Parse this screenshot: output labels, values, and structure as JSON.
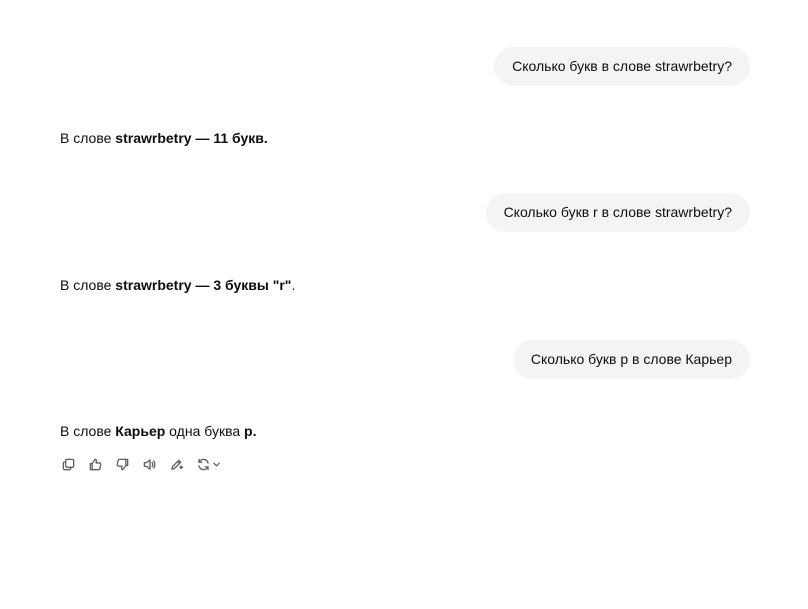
{
  "conversation": {
    "turns": [
      {
        "user": "Сколько букв в слове strawrbetry?",
        "assistant": {
          "t1": "В слове ",
          "b1": "strawrbetry — 11 букв.",
          "t2": "",
          "b2": "",
          "t3": ""
        }
      },
      {
        "user": "Сколько букв r в слове strawrbetry?",
        "assistant": {
          "t1": "В слове ",
          "b1": "strawrbetry — 3 буквы \"r\"",
          "t2": ".",
          "b2": "",
          "t3": ""
        }
      },
      {
        "user": "Сколько букв р в слове Карьер",
        "assistant": {
          "t1": "В слове ",
          "b1": "Карьер",
          "t2": " одна буква ",
          "b2": "р.",
          "t3": ""
        }
      }
    ]
  },
  "action_bar": {
    "icons": [
      "copy-icon",
      "thumbs-up-icon",
      "thumbs-down-icon",
      "speaker-icon",
      "edit-icon",
      "regenerate-icon",
      "chevron-down-icon"
    ]
  },
  "colors": {
    "user_bubble_bg": "#f4f4f4",
    "text": "#0d0d0d",
    "icon": "#5d5d5d"
  }
}
